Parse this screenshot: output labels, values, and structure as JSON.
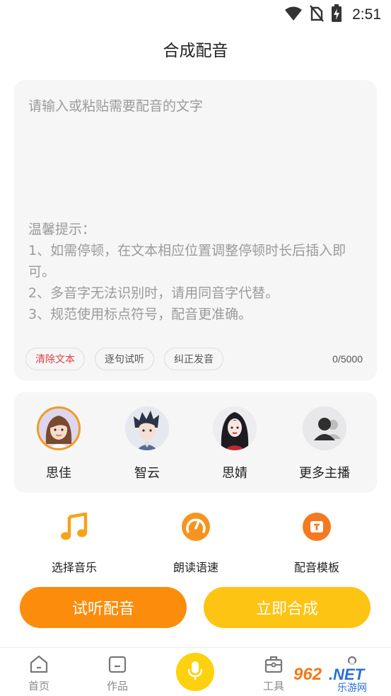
{
  "status_bar": {
    "time": "2:51",
    "icons": [
      "wifi-icon",
      "no-sim-icon",
      "battery-charging-icon"
    ]
  },
  "header": {
    "title": "合成配音"
  },
  "editor": {
    "placeholder": "请输入或粘贴需要配音的文字",
    "tips_title": "温馨提示：",
    "tips": [
      "1、如需停顿，在文本相应位置调整停顿时长后插入即可。",
      "2、多音字无法识别时，请用同音字代替。",
      "3、规范使用标点符号，配音更准确。"
    ],
    "chips": [
      "清除文本",
      "逐句试听",
      "纠正发音"
    ],
    "counter": "0/5000"
  },
  "voices": [
    {
      "name": "思佳",
      "selected": true
    },
    {
      "name": "智云",
      "selected": false
    },
    {
      "name": "思婧",
      "selected": false
    },
    {
      "name": "更多主播",
      "selected": false
    }
  ],
  "tools": [
    {
      "label": "选择音乐",
      "icon": "music-note-icon"
    },
    {
      "label": "朗读语速",
      "icon": "speed-gauge-icon"
    },
    {
      "label": "配音模板",
      "icon": "template-icon"
    }
  ],
  "buttons": {
    "preview": "试听配音",
    "synthesize": "立即合成"
  },
  "bottom_nav": {
    "items": [
      "首页",
      "作品",
      "工具"
    ],
    "center_icon": "microphone-icon"
  },
  "watermark": {
    "text": "962.NET",
    "subtext": "乐游网"
  },
  "colors": {
    "orange": "#fb8c0c",
    "yellow": "#fec413",
    "accent": "#f29a1e",
    "danger": "#e04040"
  }
}
